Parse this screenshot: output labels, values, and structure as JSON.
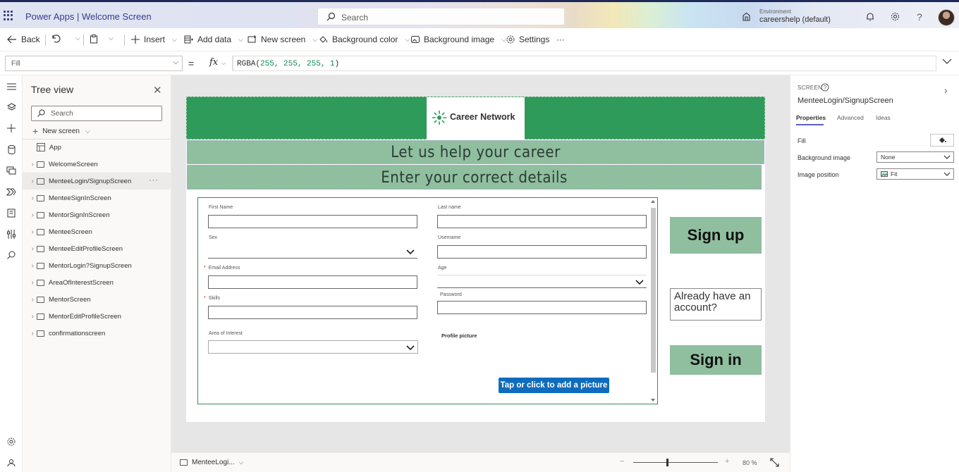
{
  "titlebar": {
    "app_title": "Power Apps  |  Welcome Screen",
    "search_placeholder": "Search",
    "environment_label": "Environment",
    "environment_value": "careershelp (default)",
    "help_glyph": "?"
  },
  "commandbar": {
    "back": "Back",
    "insert": "Insert",
    "add_data": "Add data",
    "new_screen": "New screen",
    "background_color": "Background color",
    "background_image": "Background image",
    "settings": "Settings",
    "more": "···"
  },
  "formulabar": {
    "property": "Fill",
    "equals": "=",
    "fx": "fx",
    "formula_fn": "RGBA(",
    "formula_args": "255, 255, 255, 1",
    "formula_close": ")"
  },
  "tree": {
    "title": "Tree view",
    "search_placeholder": "Search",
    "new_screen": "New screen",
    "items": [
      {
        "label": "App",
        "type": "app"
      },
      {
        "label": "WelcomeScreen"
      },
      {
        "label": "MenteeLogin/SignupScreen",
        "selected": true
      },
      {
        "label": "MenteeSignInScreen"
      },
      {
        "label": "MentorSignInScreen"
      },
      {
        "label": "MenteeScreen"
      },
      {
        "label": "MenteeEditProfileScreen"
      },
      {
        "label": "MentorLogin?SignupScreen"
      },
      {
        "label": "AreaOfInterestScreen"
      },
      {
        "label": "MentorScreen"
      },
      {
        "label": "MentorEditProfileScreen"
      },
      {
        "label": "confirmationscreen"
      }
    ],
    "more": "···"
  },
  "screen": {
    "logo_text": "Career Network",
    "banner1": "Let us help your career",
    "banner2": "Enter your correct details",
    "form": {
      "first_name": "First Name",
      "last_name": "Last name",
      "sex": "Sex",
      "username": "Username",
      "email": "Email Address",
      "age": "Age",
      "skills": "Skills",
      "password": "Password",
      "area_of_interest": "Area of Interest",
      "profile_picture": "Profile picture",
      "add_picture": "Tap or click to add a picture",
      "required_mark": "*"
    },
    "signup": "Sign up",
    "already": "Already have an account?",
    "signin": "Sign in"
  },
  "statusbar": {
    "screen_name": "MenteeLogi...",
    "zoom_minus": "−",
    "zoom_plus": "+",
    "zoom_value": "80  %",
    "zoom_level": 0.4
  },
  "properties": {
    "type": "SCREEN",
    "name": "MenteeLogin/SignupScreen",
    "tabs": [
      "Properties",
      "Advanced",
      "Ideas"
    ],
    "fill_label": "Fill",
    "background_image_label": "Background image",
    "background_image_value": "None",
    "image_position_label": "Image position",
    "image_position_value": "Fit",
    "collapse_glyph": "›"
  },
  "colors": {
    "header_green": "#2e9b5a",
    "banner_green": "#8fbf9f",
    "accent_blue": "#0f6cbd",
    "title_text": "#3a3a8c"
  }
}
